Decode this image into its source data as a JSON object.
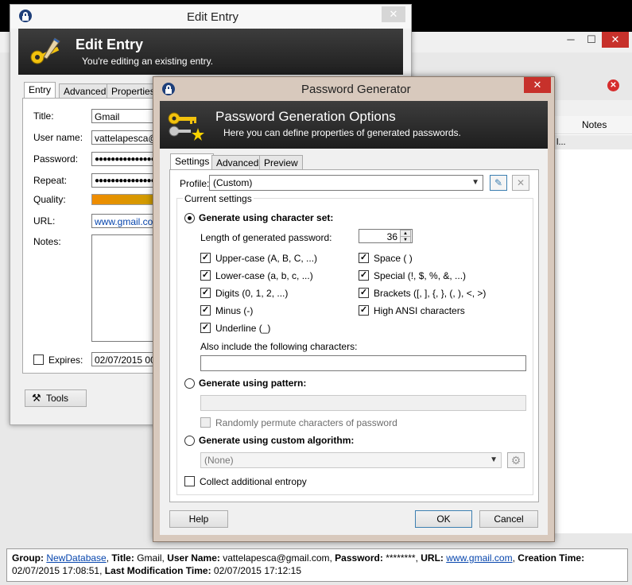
{
  "main": {
    "minimize": "─",
    "maximize": "☐",
    "close": "✕",
    "grid_header": "Notes",
    "grid_cell": "l..."
  },
  "status": {
    "group_label": "Group:",
    "group_value": "NewDatabase",
    "title_label": "Title:",
    "title_value": "Gmail",
    "user_label": "User Name:",
    "user_value": "vattelapesca@gmail.com",
    "password_label": "Password:",
    "password_value": "********",
    "url_label": "URL:",
    "url_value": "www.gmail.com",
    "ctime_label": "Creation Time:",
    "ctime_value": "02/07/2015 17:08:51",
    "mtime_label": "Last Modification Time:",
    "mtime_value": "02/07/2015 17:12:15"
  },
  "edit": {
    "window_title": "Edit Entry",
    "close": "✕",
    "banner_title": "Edit Entry",
    "banner_sub": "You're editing an existing entry.",
    "tabs": [
      "Entry",
      "Advanced",
      "Properties"
    ],
    "title_label": "Title:",
    "title_value": "Gmail",
    "user_label": "User name:",
    "user_value": "vattelapesca@gmail.com",
    "password_label": "Password:",
    "password_value": "●●●●●●●●●●●●●●●●",
    "repeat_label": "Repeat:",
    "repeat_value": "●●●●●●●●●●●●●●●●",
    "quality_label": "Quality:",
    "url_label": "URL:",
    "url_value": "www.gmail.com",
    "notes_label": "Notes:",
    "expires_label": "Expires:",
    "expires_value": "02/07/2015 00:",
    "tools_label": "Tools"
  },
  "pg": {
    "window_title": "Password Generator",
    "close": "✕",
    "banner_title": "Password Generation Options",
    "banner_sub": "Here you can define properties of generated passwords.",
    "tabs": [
      "Settings",
      "Advanced",
      "Preview"
    ],
    "profile_label": "Profile:",
    "profile_value": "(Custom)",
    "current_settings": "Current settings",
    "opt_charset": "Generate using character set:",
    "length_label": "Length of generated password:",
    "length_value": "36",
    "checks_left": [
      {
        "label": "Upper-case (A, B, C, ...)",
        "checked": true
      },
      {
        "label": "Lower-case (a, b, c, ...)",
        "checked": true
      },
      {
        "label": "Digits (0, 1, 2, ...)",
        "checked": true
      },
      {
        "label": "Minus (-)",
        "checked": true
      },
      {
        "label": "Underline (_)",
        "checked": true
      }
    ],
    "checks_right": [
      {
        "label": "Space ( )",
        "checked": true
      },
      {
        "label": "Special (!, $, %, &, ...)",
        "checked": true
      },
      {
        "label": "Brackets ([, ], {, }, (, ), <, >)",
        "checked": true
      },
      {
        "label": "High ANSI characters",
        "checked": true
      }
    ],
    "also_include": "Also include the following characters:",
    "opt_pattern": "Generate using pattern:",
    "permute_label": "Randomly permute characters of password",
    "opt_custom": "Generate using custom algorithm:",
    "custom_value": "(None)",
    "entropy_label": "Collect additional entropy",
    "help": "Help",
    "ok": "OK",
    "cancel": "Cancel",
    "check_mark": "✓",
    "combo_arrow": "▼",
    "spin_up": "▲",
    "spin_down": "▼",
    "gear": "⚙",
    "delete_x": "✕",
    "save_pencil": "✎"
  },
  "colors": {
    "banner_bg": "#2a2a2a",
    "quality_start": "#f08c00",
    "quality_end": "#c8a000",
    "pg_frame": "#d8c9bd",
    "close_red": "#c7312b",
    "focus_blue": "#3c7fb1"
  }
}
